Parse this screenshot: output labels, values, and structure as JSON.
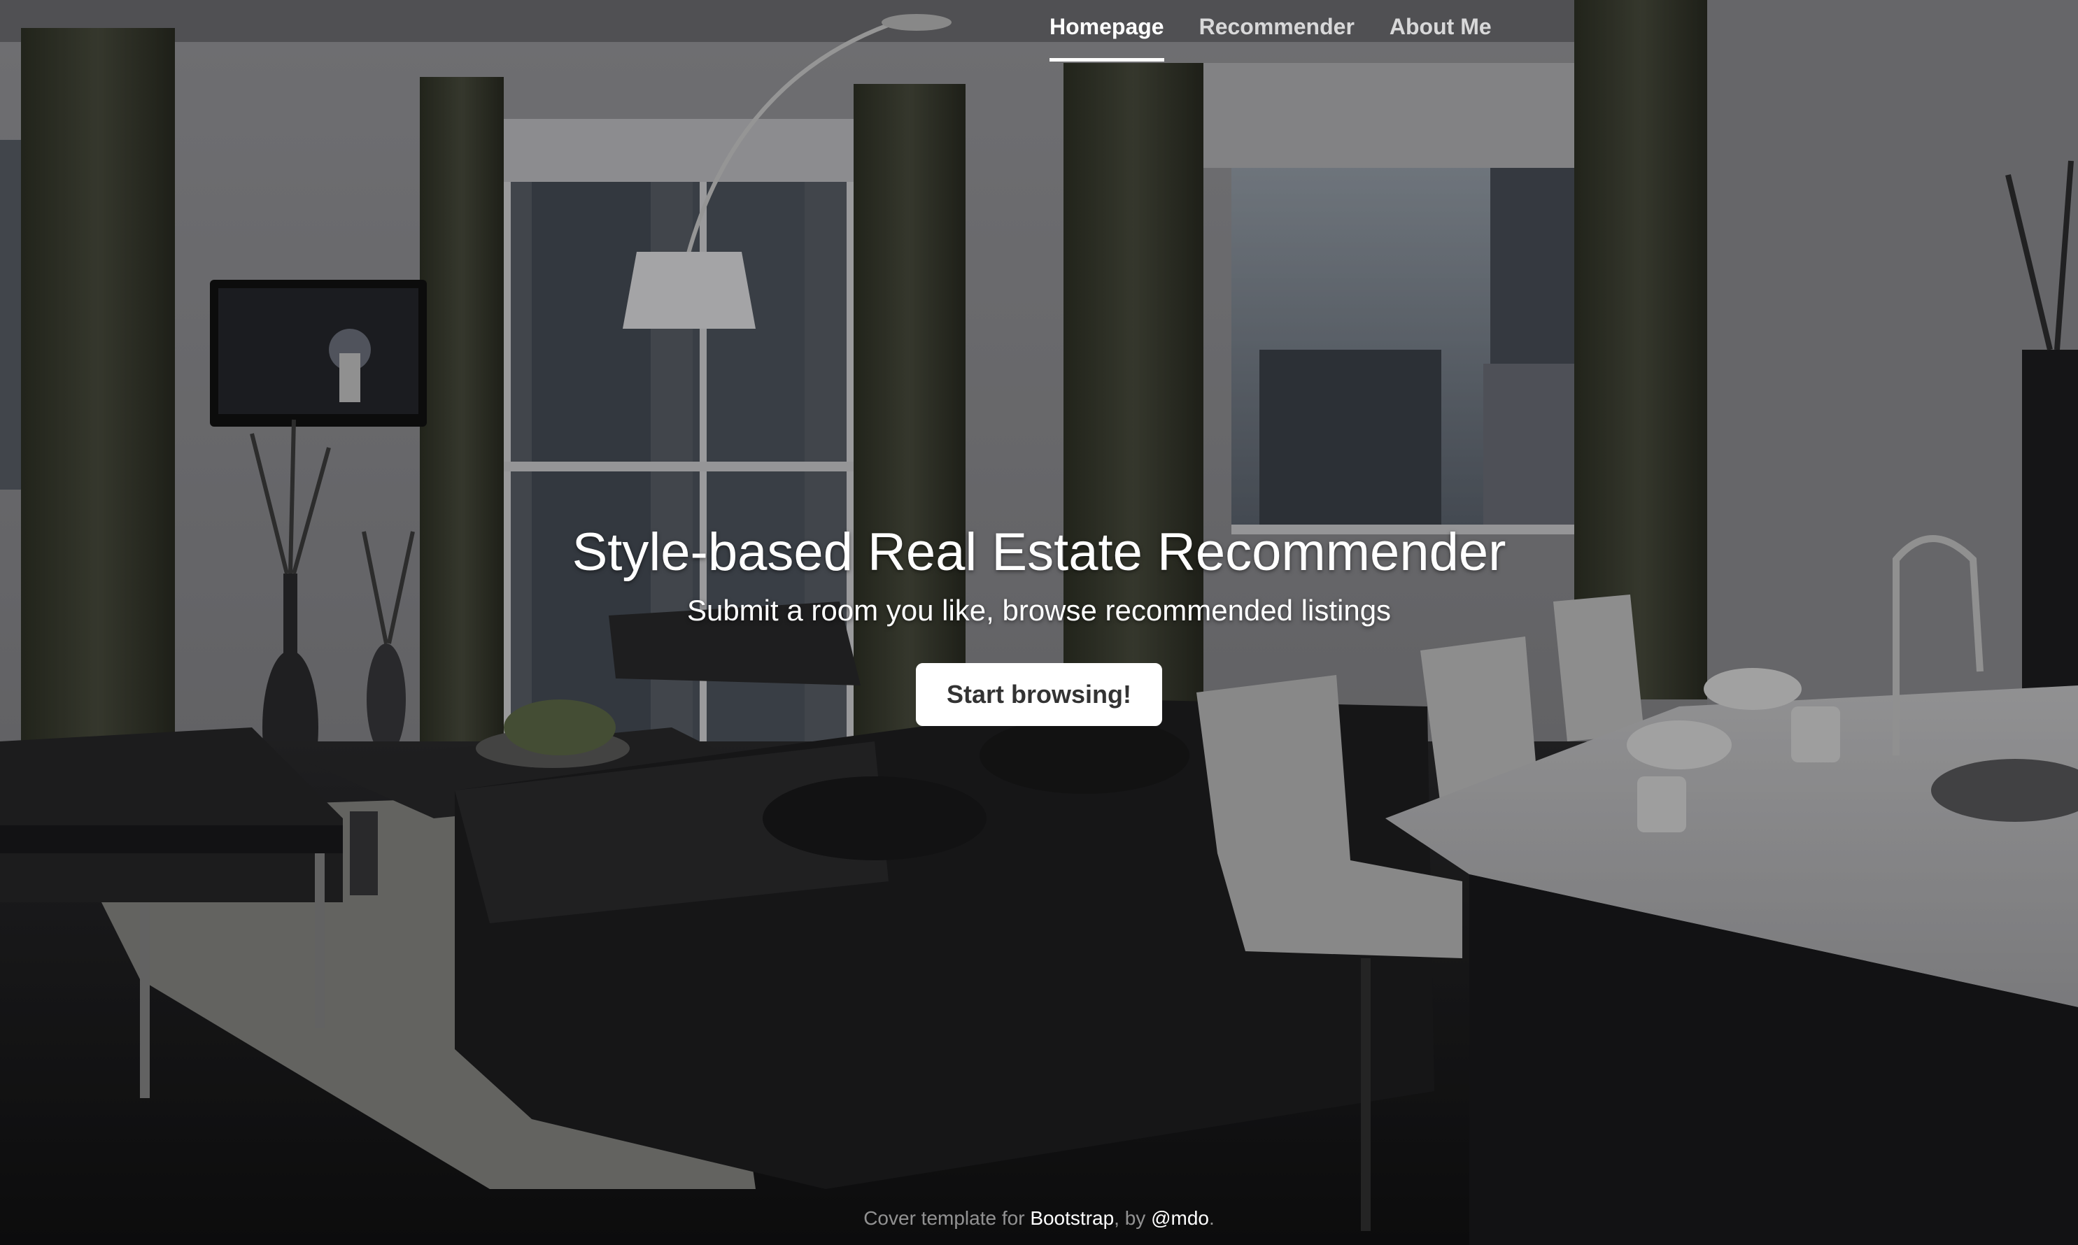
{
  "nav": {
    "items": [
      {
        "label": "Homepage",
        "active": true
      },
      {
        "label": "Recommender",
        "active": false
      },
      {
        "label": "About Me",
        "active": false
      }
    ]
  },
  "hero": {
    "title": "Style-based Real Estate Recommender",
    "subtitle": "Submit a room you like, browse recommended listings",
    "button_label": "Start browsing!"
  },
  "footer": {
    "prefix": "Cover template for ",
    "link1": "Bootstrap",
    "middle": ", by ",
    "link2": "@mdo",
    "suffix": "."
  },
  "colors": {
    "button_bg": "#ffffff",
    "button_text": "#333333",
    "text": "#ffffff"
  }
}
